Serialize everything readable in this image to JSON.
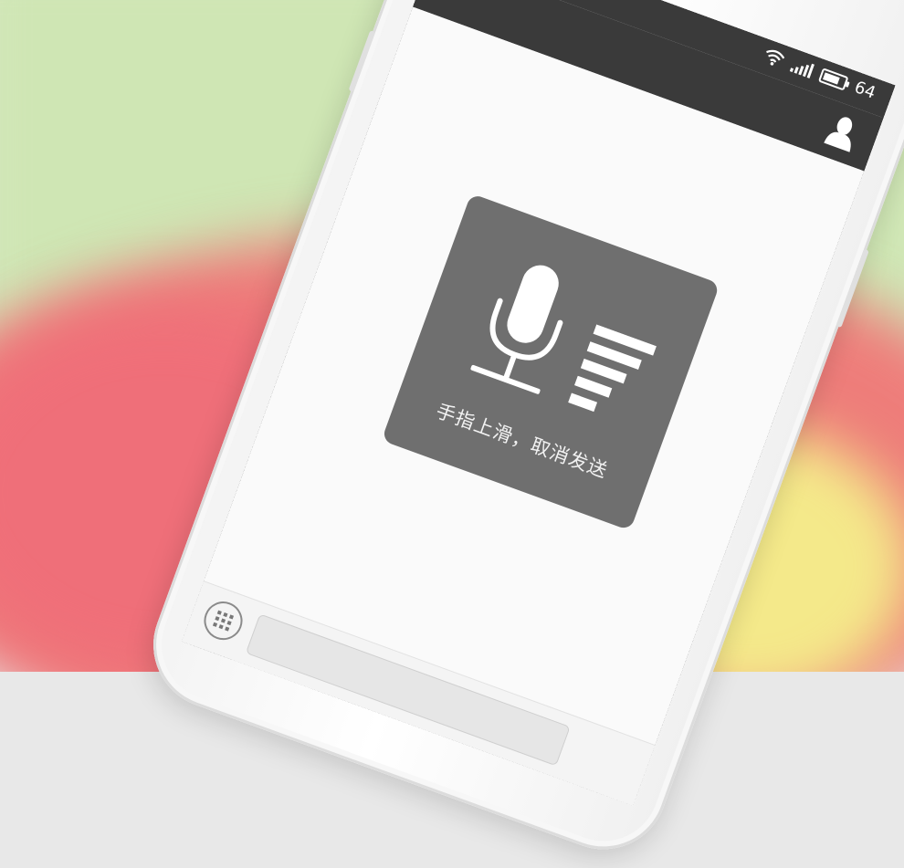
{
  "status_bar": {
    "battery_level": "64",
    "icons": [
      "wifi-icon",
      "signal-icon",
      "battery-icon"
    ]
  },
  "nav_bar": {
    "right_icon": "person-icon"
  },
  "voice_popup": {
    "hint": "手指上滑，取消发送",
    "icons": [
      "microphone-icon",
      "volume-level-icon"
    ]
  },
  "bottom_bar": {
    "left_icon": "keyboard-icon"
  },
  "colors": {
    "header": "#3a3a3a",
    "popup": "#6f6f6f",
    "popup_text": "#f2f2f2"
  }
}
